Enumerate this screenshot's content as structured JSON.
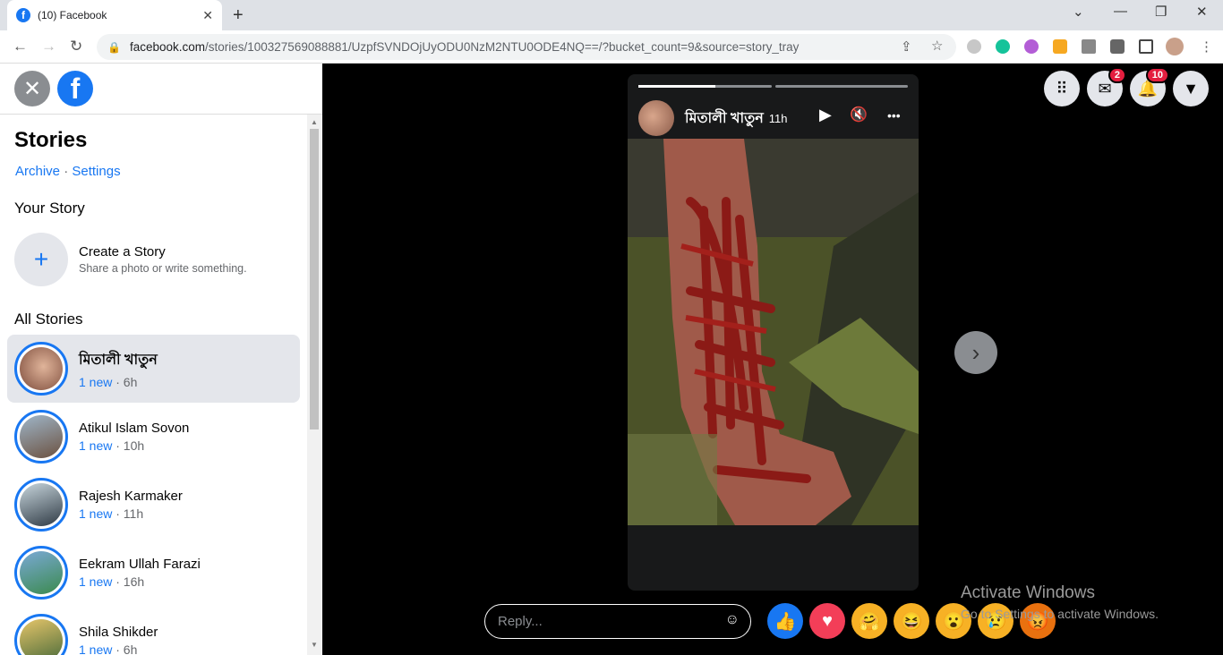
{
  "browser": {
    "tab_title": "(10) Facebook",
    "tab_close": "✕",
    "new_tab": "+",
    "window_controls": [
      "⌄",
      "—",
      "❐",
      "✕"
    ],
    "url_host": "facebook.com",
    "url_path": "/stories/100327569088881/UzpfSVNDOjUyODU0NzM2NTU0ODE4NQ==/?bucket_count=9&source=story_tray",
    "nav_icons": [
      "back-icon",
      "forward-icon",
      "reload-icon"
    ]
  },
  "sidebar": {
    "close_glyph": "✕",
    "logo_glyph": "f",
    "title": "Stories",
    "archive_link": "Archive",
    "separator": " · ",
    "settings_link": "Settings",
    "your_story": "Your Story",
    "create_title": "Create a Story",
    "create_subtitle": "Share a photo or write something.",
    "plus_glyph": "+",
    "all_stories": "All Stories",
    "stories": [
      {
        "name": "মিতালী খাতুন",
        "new": "1 new",
        "time": " · 6h"
      },
      {
        "name": "Atikul Islam Sovon",
        "new": "1 new",
        "time": " · 10h"
      },
      {
        "name": "Rajesh Karmaker",
        "new": "1 new",
        "time": " · 11h"
      },
      {
        "name": "Eekram Ullah Farazi",
        "new": "1 new",
        "time": " · 16h"
      },
      {
        "name": "Shila Shikder",
        "new": "1 new",
        "time": " · 6h"
      }
    ]
  },
  "viewer": {
    "story_author": "মিতালী খাতুন",
    "story_time": "11h",
    "progress": [
      0.58,
      0.0
    ],
    "play_glyph": "▶",
    "mute_glyph": "🔇",
    "more_glyph": "•••",
    "next_glyph": "›",
    "reply_placeholder": "Reply...",
    "reactions": [
      "like",
      "love",
      "care",
      "haha",
      "wow",
      "sad",
      "angry"
    ],
    "messenger_badge": "2",
    "notifications_badge": "10"
  },
  "windows_watermark": {
    "line1": "Activate Windows",
    "line2": "Go to Settings to activate Windows."
  },
  "colors": {
    "facebook_blue": "#1877f2",
    "badge_red": "#e41e3f"
  }
}
